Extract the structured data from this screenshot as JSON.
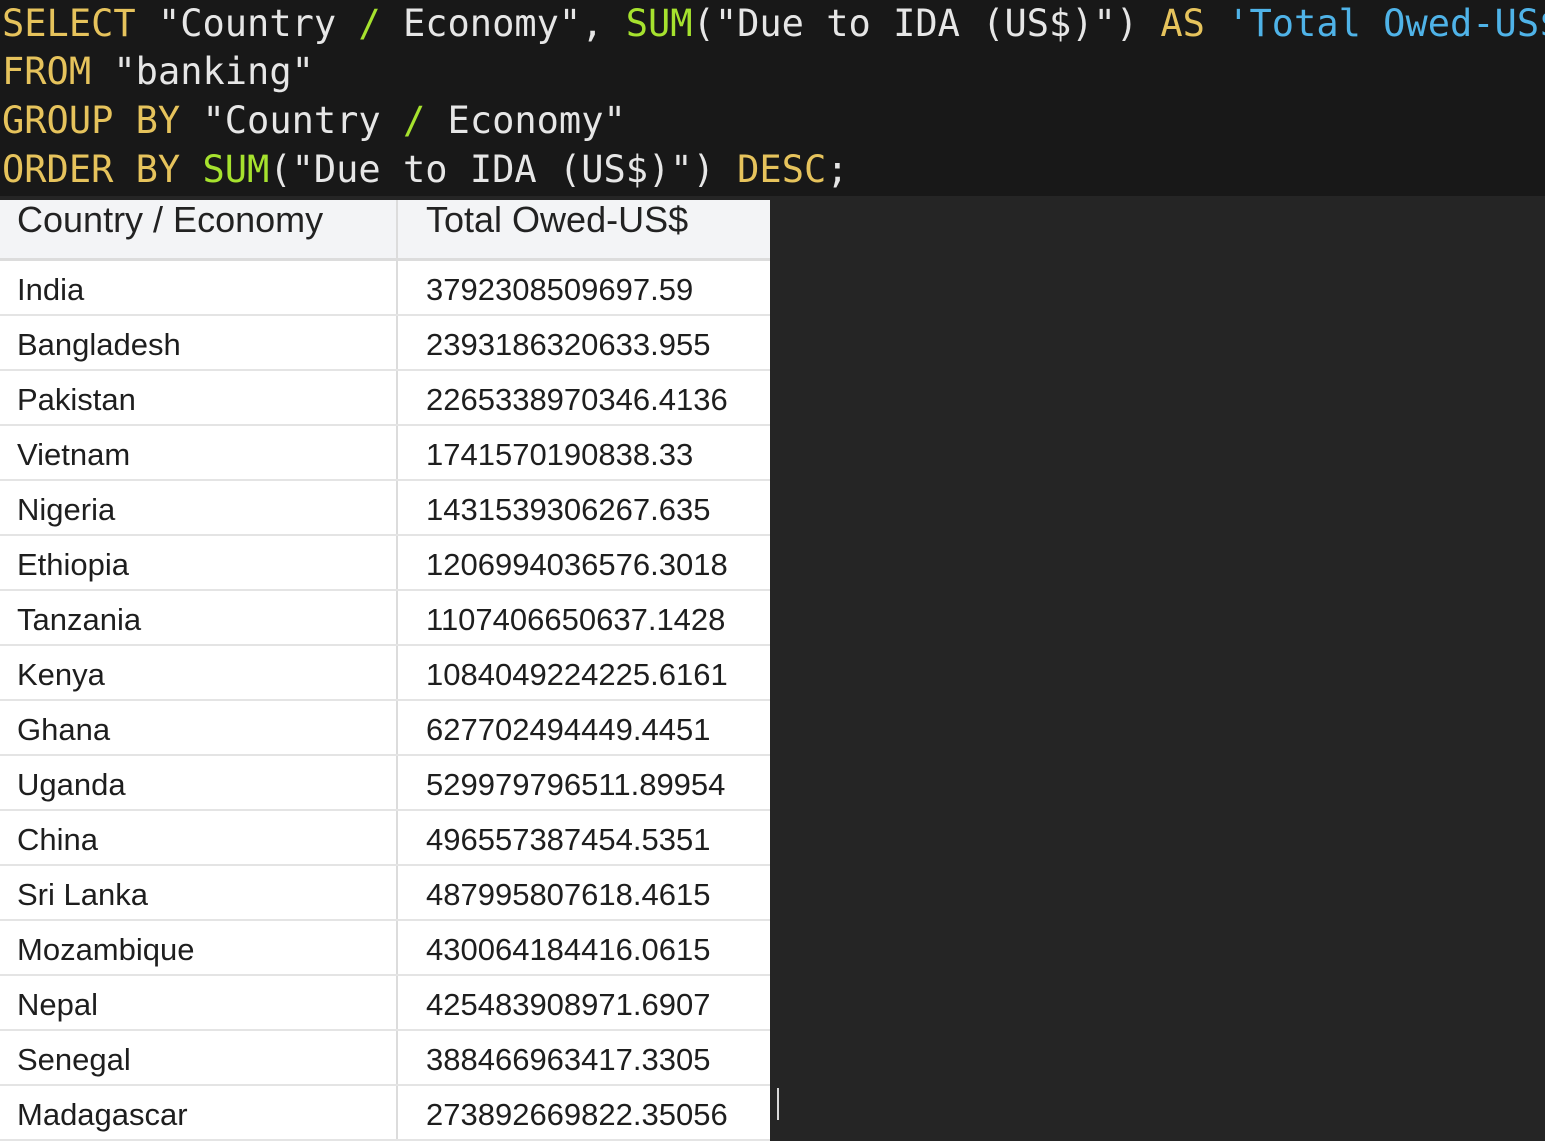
{
  "editor": {
    "lines": [
      [
        {
          "t": "SELECT",
          "c": "kw"
        },
        {
          "t": " ",
          "c": "punct"
        },
        {
          "t": "\"Country ",
          "c": "str"
        },
        {
          "t": "/",
          "c": "op"
        },
        {
          "t": " Economy\"",
          "c": "str"
        },
        {
          "t": ", ",
          "c": "punct"
        },
        {
          "t": "SUM",
          "c": "fn"
        },
        {
          "t": "(",
          "c": "punct"
        },
        {
          "t": "\"Due to IDA (US$)\"",
          "c": "str"
        },
        {
          "t": ") ",
          "c": "punct"
        },
        {
          "t": "AS",
          "c": "kw"
        },
        {
          "t": " ",
          "c": "punct"
        },
        {
          "t": "'Total Owed-US$'",
          "c": "alias"
        }
      ],
      [
        {
          "t": "FROM",
          "c": "kw"
        },
        {
          "t": " ",
          "c": "punct"
        },
        {
          "t": "\"banking\"",
          "c": "str"
        }
      ],
      [
        {
          "t": "GROUP BY",
          "c": "kw"
        },
        {
          "t": " ",
          "c": "punct"
        },
        {
          "t": "\"Country ",
          "c": "str"
        },
        {
          "t": "/",
          "c": "op"
        },
        {
          "t": " Economy\"",
          "c": "str"
        }
      ],
      [
        {
          "t": "ORDER BY",
          "c": "kw"
        },
        {
          "t": " ",
          "c": "punct"
        },
        {
          "t": "SUM",
          "c": "fn"
        },
        {
          "t": "(",
          "c": "punct"
        },
        {
          "t": "\"Due to IDA (US$)\"",
          "c": "str"
        },
        {
          "t": ") ",
          "c": "punct"
        },
        {
          "t": "DESC",
          "c": "kw"
        },
        {
          "t": ";",
          "c": "punct"
        }
      ]
    ]
  },
  "results": {
    "columns": [
      "Country / Economy",
      "Total Owed-US$"
    ],
    "rows": [
      [
        "India",
        "3792308509697.59"
      ],
      [
        "Bangladesh",
        "2393186320633.955"
      ],
      [
        "Pakistan",
        "2265338970346.4136"
      ],
      [
        "Vietnam",
        "1741570190838.33"
      ],
      [
        "Nigeria",
        "1431539306267.635"
      ],
      [
        "Ethiopia",
        "1206994036576.3018"
      ],
      [
        "Tanzania",
        "1107406650637.1428"
      ],
      [
        "Kenya",
        "1084049224225.6161"
      ],
      [
        "Ghana",
        "627702494449.4451"
      ],
      [
        "Uganda",
        "529979796511.89954"
      ],
      [
        "China",
        "496557387454.5351"
      ],
      [
        "Sri Lanka",
        "487995807618.4615"
      ],
      [
        "Mozambique",
        "430064184416.0615"
      ],
      [
        "Nepal",
        "425483908971.6907"
      ],
      [
        "Senegal",
        "388466963417.3305"
      ],
      [
        "Madagascar",
        "273892669822.35056"
      ]
    ]
  },
  "colors": {
    "editor_bg": "#181818",
    "keyword": "#e6c35c",
    "function": "#a6e22e",
    "alias": "#4fb3e8",
    "results_bg": "#252525"
  }
}
